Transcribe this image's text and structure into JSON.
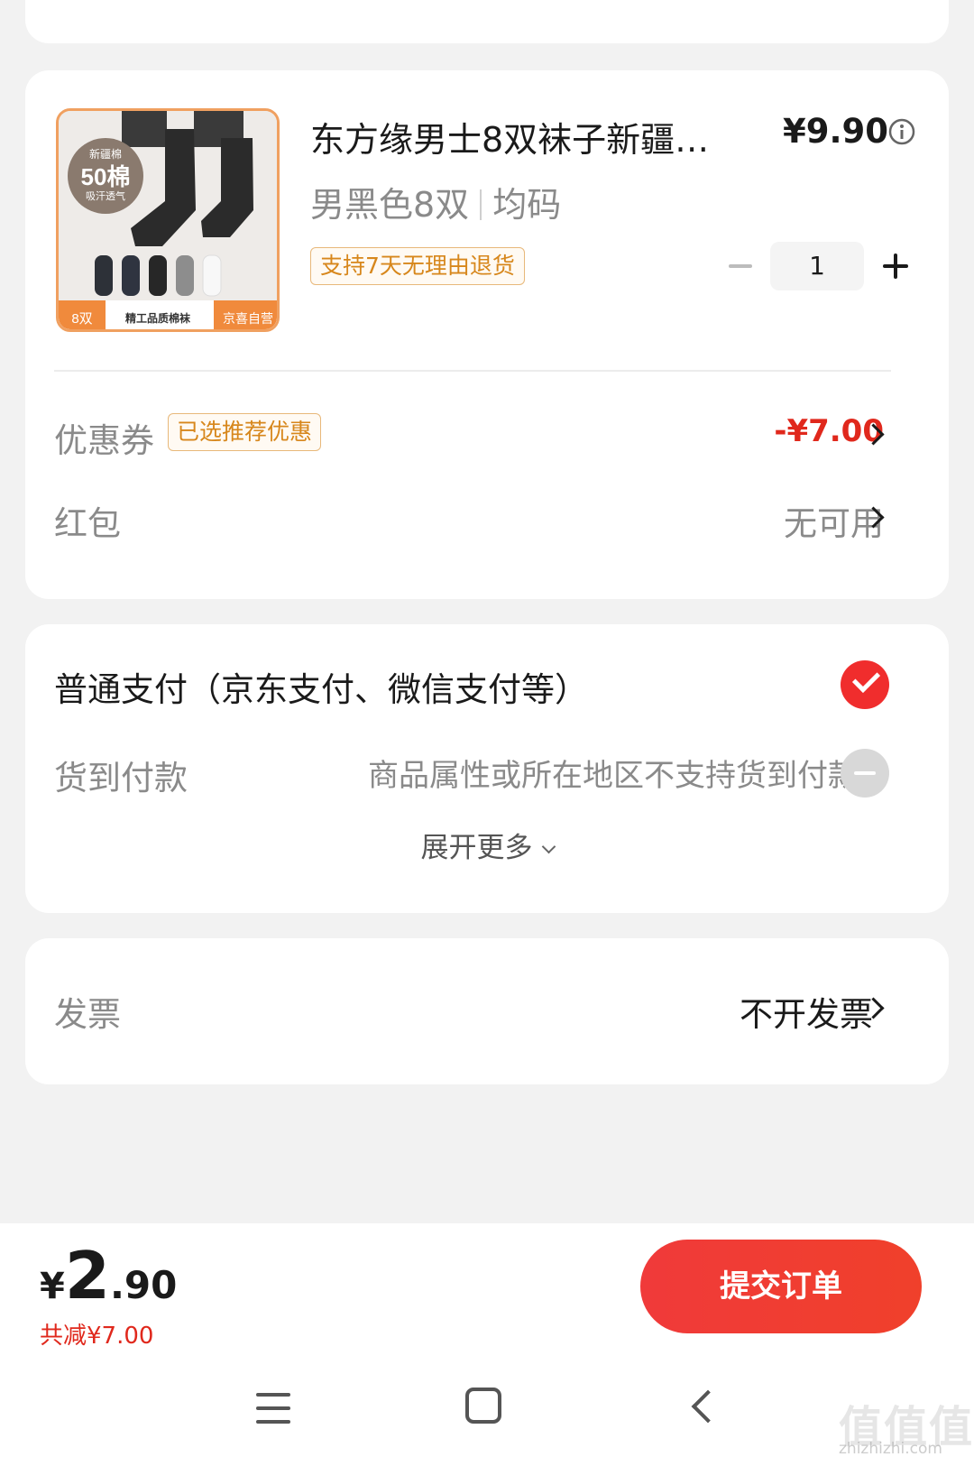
{
  "product": {
    "title": "东方缘男士8双袜子新疆…",
    "price": "¥9.90",
    "spec_color": "男黑色8双",
    "spec_size": "均码",
    "return_policy": "支持7天无理由退货",
    "quantity": "1",
    "image_texts": {
      "badge_top": "新疆棉",
      "badge_main": "50棉",
      "badge_sub": "吸汗透气",
      "count": "8双",
      "quality": "精工品质棉袜",
      "brand": "京喜自营"
    }
  },
  "coupon": {
    "label": "优惠券",
    "badge": "已选推荐优惠",
    "value": "-¥7.00"
  },
  "red_packet": {
    "label": "红包",
    "value": "无可用"
  },
  "payment": {
    "normal_label": "普通支付（京东支付、微信支付等）",
    "cod_label": "货到付款",
    "cod_desc": "商品属性或所在地区不支持货到付款",
    "expand_label": "展开更多"
  },
  "invoice": {
    "label": "发票",
    "value": "不开发票"
  },
  "summary": {
    "currency": "¥",
    "total_int": "2",
    "total_dec": ".90",
    "discount_text": "共减¥7.00",
    "submit_label": "提交订单"
  },
  "watermark": {
    "text": "值值值",
    "url": "zhizhizhi.com"
  },
  "colors": {
    "accent_red": "#e0281c",
    "badge_orange": "#d7871c",
    "submit_bg": "#f03a3a"
  }
}
